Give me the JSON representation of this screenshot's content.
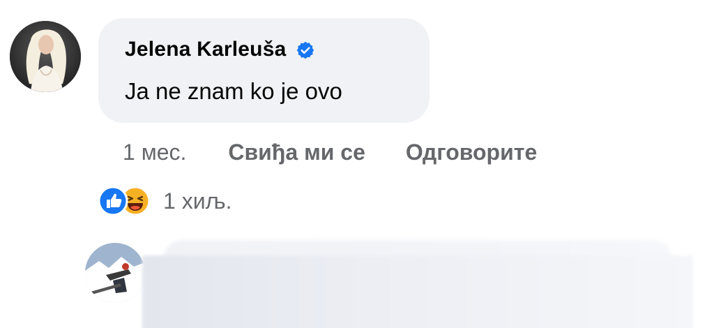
{
  "comment": {
    "author": "Jelena Karleuša",
    "verified": true,
    "verified_icon": "verified-badge-icon",
    "text": "Ja ne znam ko je ovo",
    "time": "1 мес.",
    "like_label": "Свиђа ми се",
    "reply_label": "Одговорите",
    "reactions": {
      "icons": [
        "like-reaction-icon",
        "haha-reaction-icon"
      ],
      "count": "1 хиљ."
    }
  },
  "reply": {
    "blurred": true
  },
  "colors": {
    "bubble": "#f0f2f5",
    "secondary_text": "#65676b",
    "primary_text": "#050505",
    "verified_blue": "#1877f2",
    "haha_yellow": "#f7b125"
  }
}
